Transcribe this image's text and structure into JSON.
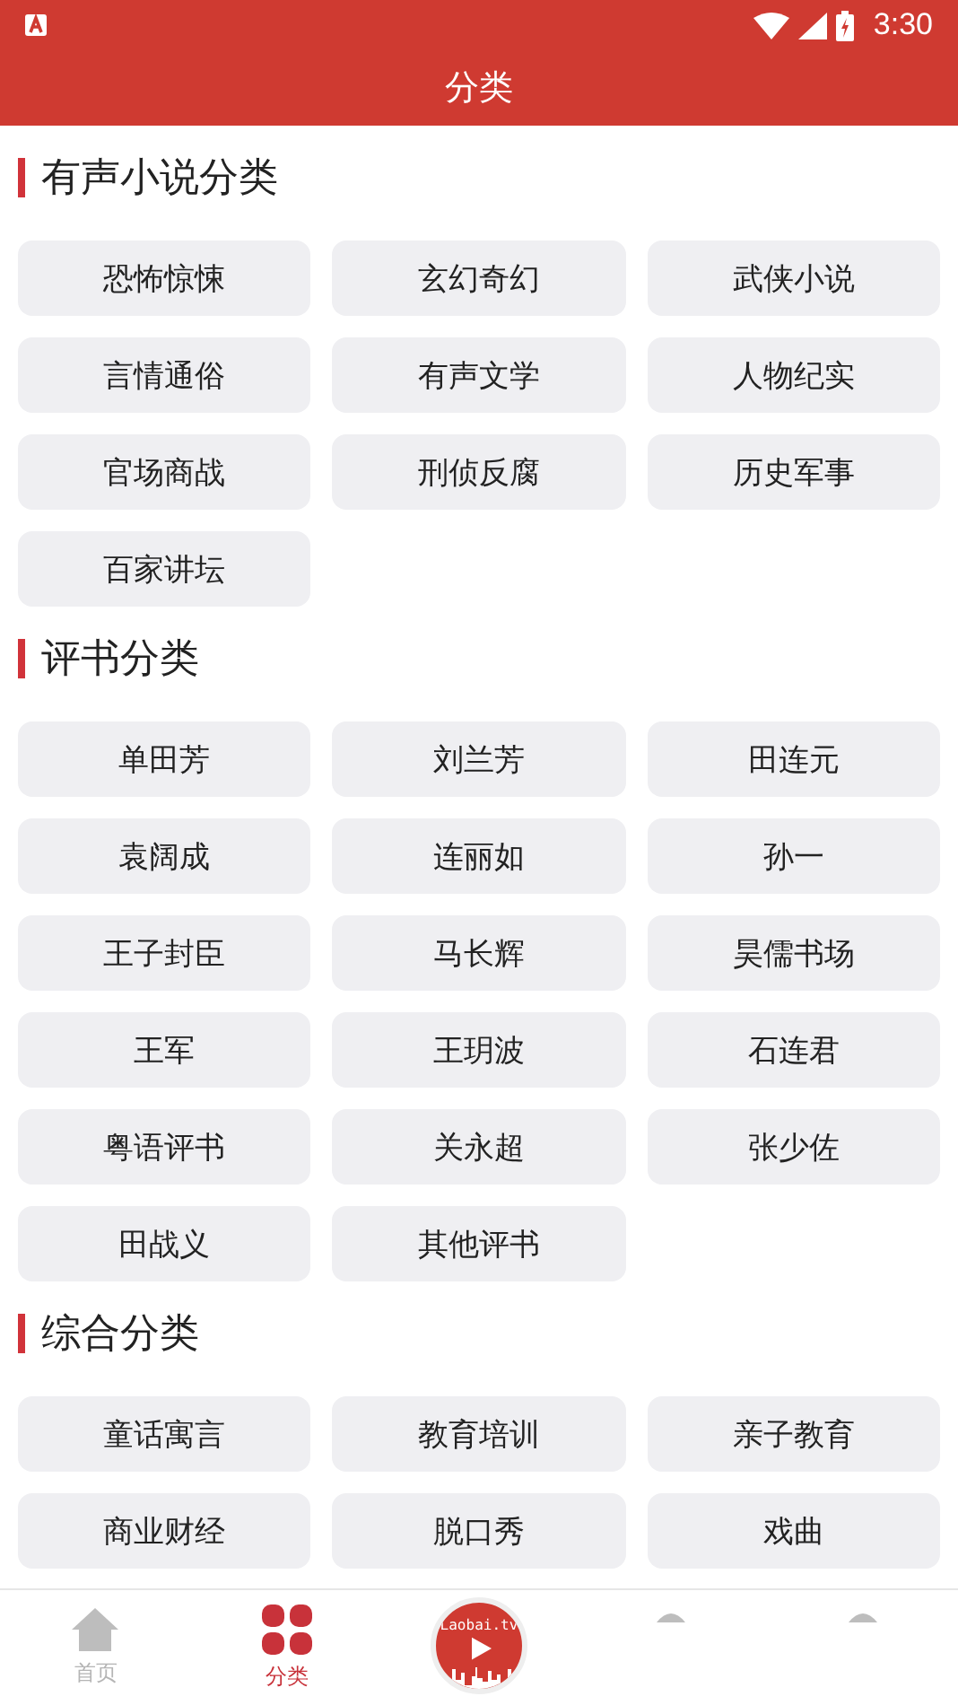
{
  "status_bar": {
    "time": "3:30"
  },
  "header": {
    "title": "分类"
  },
  "sections": [
    {
      "title": "有声小说分类",
      "items": [
        "恐怖惊悚",
        "玄幻奇幻",
        "武侠小说",
        "言情通俗",
        "有声文学",
        "人物纪实",
        "官场商战",
        "刑侦反腐",
        "历史军事",
        "百家讲坛"
      ]
    },
    {
      "title": "评书分类",
      "items": [
        "单田芳",
        "刘兰芳",
        "田连元",
        "袁阔成",
        "连丽如",
        "孙一",
        "王子封臣",
        "马长辉",
        "昊儒书场",
        "王军",
        "王玥波",
        "石连君",
        "粤语评书",
        "关永超",
        "张少佐",
        "田战义",
        "其他评书"
      ]
    },
    {
      "title": "综合分类",
      "items": [
        "童话寓言",
        "教育培训",
        "亲子教育",
        "商业财经",
        "脱口秀",
        "戏曲"
      ]
    }
  ],
  "nav": [
    {
      "kind": "home",
      "label": "首页",
      "selected": false
    },
    {
      "kind": "category",
      "label": "分类",
      "selected": true
    },
    {
      "kind": "logo",
      "label": "Laobai.tv"
    },
    {
      "kind": "hidden"
    },
    {
      "kind": "hidden"
    }
  ]
}
